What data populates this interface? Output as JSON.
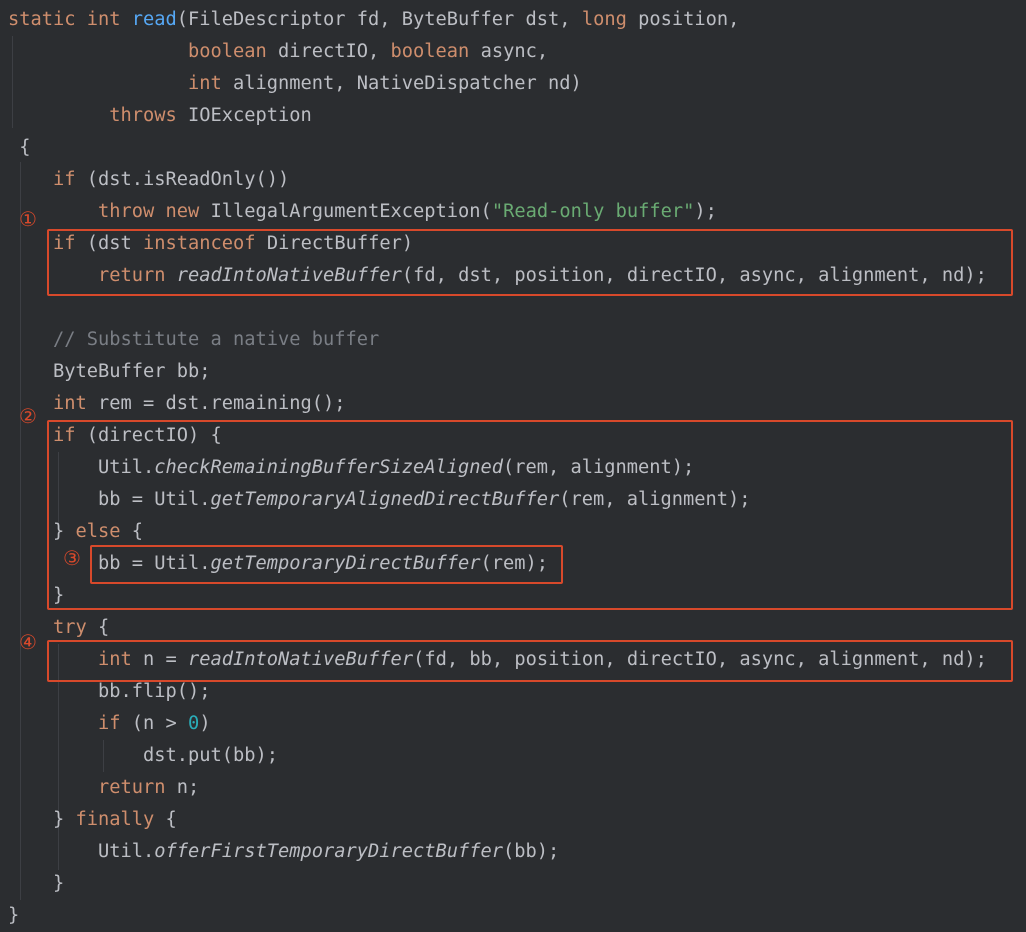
{
  "colors": {
    "background": "#2b2d30",
    "text": "#bcbec4",
    "keyword": "#cf8e6d",
    "method": "#56a8f5",
    "string": "#6aab73",
    "comment": "#7a7e85",
    "number": "#2aacb8",
    "annotation": "#d8492b"
  },
  "code": [
    [
      {
        "t": "static int ",
        "c": "kw"
      },
      {
        "t": "read",
        "c": "fn"
      },
      {
        "t": "(FileDescriptor fd, ByteBuffer dst, "
      },
      {
        "t": "long",
        "c": "kw"
      },
      {
        "t": " position,"
      }
    ],
    [
      {
        "t": "                "
      },
      {
        "t": "boolean",
        "c": "kw"
      },
      {
        "t": " directIO, "
      },
      {
        "t": "boolean",
        "c": "kw"
      },
      {
        "t": " async,"
      }
    ],
    [
      {
        "t": "                "
      },
      {
        "t": "int",
        "c": "kw"
      },
      {
        "t": " alignment, NativeDispatcher nd)"
      }
    ],
    [
      {
        "t": "         "
      },
      {
        "t": "throws",
        "c": "kw"
      },
      {
        "t": " IOException"
      }
    ],
    [
      {
        "t": " {"
      }
    ],
    [
      {
        "t": "    "
      },
      {
        "t": "if",
        "c": "kw"
      },
      {
        "t": " (dst.isReadOnly())"
      }
    ],
    [
      {
        "t": "        "
      },
      {
        "t": "throw new",
        "c": "kw"
      },
      {
        "t": " IllegalArgumentException("
      },
      {
        "t": "\"Read-only buffer\"",
        "c": "st"
      },
      {
        "t": ");"
      }
    ],
    [
      {
        "t": "    "
      },
      {
        "t": "if",
        "c": "kw"
      },
      {
        "t": " (dst "
      },
      {
        "t": "instanceof",
        "c": "kw"
      },
      {
        "t": " DirectBuffer)"
      }
    ],
    [
      {
        "t": "        "
      },
      {
        "t": "return",
        "c": "kw"
      },
      {
        "t": " "
      },
      {
        "t": "readIntoNativeBuffer",
        "c": "it"
      },
      {
        "t": "(fd, dst, position, directIO, async, alignment, nd);"
      }
    ],
    [
      {
        "t": ""
      }
    ],
    [
      {
        "t": "    "
      },
      {
        "t": "// Substitute a native buffer",
        "c": "cm"
      }
    ],
    [
      {
        "t": "    ByteBuffer bb;"
      }
    ],
    [
      {
        "t": "    "
      },
      {
        "t": "int",
        "c": "kw"
      },
      {
        "t": " rem = dst.remaining();"
      }
    ],
    [
      {
        "t": "    "
      },
      {
        "t": "if",
        "c": "kw"
      },
      {
        "t": " (directIO) {"
      }
    ],
    [
      {
        "t": "        Util."
      },
      {
        "t": "checkRemainingBufferSizeAligned",
        "c": "it"
      },
      {
        "t": "(rem, alignment);"
      }
    ],
    [
      {
        "t": "        bb = Util."
      },
      {
        "t": "getTemporaryAlignedDirectBuffer",
        "c": "it"
      },
      {
        "t": "(rem, alignment);"
      }
    ],
    [
      {
        "t": "    } "
      },
      {
        "t": "else",
        "c": "kw"
      },
      {
        "t": " {"
      }
    ],
    [
      {
        "t": "        bb = Util."
      },
      {
        "t": "getTemporaryDirectBuffer",
        "c": "it"
      },
      {
        "t": "(rem);"
      }
    ],
    [
      {
        "t": "    }"
      }
    ],
    [
      {
        "t": "    "
      },
      {
        "t": "try",
        "c": "kw"
      },
      {
        "t": " {"
      }
    ],
    [
      {
        "t": "        "
      },
      {
        "t": "int",
        "c": "kw"
      },
      {
        "t": " n = "
      },
      {
        "t": "readIntoNativeBuffer",
        "c": "it"
      },
      {
        "t": "(fd, bb, position, directIO, async, alignment, nd);"
      }
    ],
    [
      {
        "t": "        bb.flip();"
      }
    ],
    [
      {
        "t": "        "
      },
      {
        "t": "if",
        "c": "kw"
      },
      {
        "t": " (n > "
      },
      {
        "t": "0",
        "c": "nu"
      },
      {
        "t": ")"
      }
    ],
    [
      {
        "t": "            dst.put(bb);"
      }
    ],
    [
      {
        "t": "        "
      },
      {
        "t": "return",
        "c": "kw"
      },
      {
        "t": " n;"
      }
    ],
    [
      {
        "t": "    } "
      },
      {
        "t": "finally",
        "c": "kw"
      },
      {
        "t": " {"
      }
    ],
    [
      {
        "t": "        Util."
      },
      {
        "t": "offerFirstTemporaryDirectBuffer",
        "c": "it"
      },
      {
        "t": "(bb);"
      }
    ],
    [
      {
        "t": "    }"
      }
    ],
    [
      {
        "t": "}"
      }
    ]
  ],
  "annotations": {
    "marker_1": "①",
    "marker_2": "②",
    "marker_3": "③",
    "marker_4": "④"
  }
}
